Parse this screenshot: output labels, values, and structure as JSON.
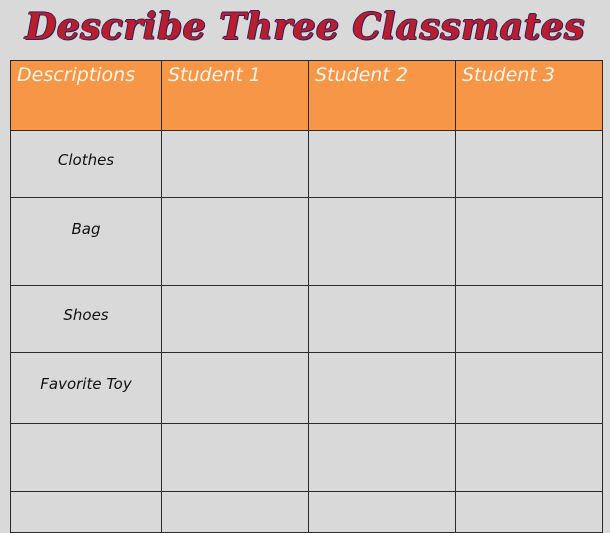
{
  "title": "Describe Three Classmates",
  "colors": {
    "title_fill": "#b81e2e",
    "title_outline": "#3a1f5a",
    "header_background": "#f79646",
    "header_text": "#fdf5ea",
    "cell_background": "#d9d9d9",
    "grid_line": "#2b2b2b"
  },
  "table": {
    "headers": [
      "Descriptions",
      "Student 1",
      "Student 2",
      "Student  3"
    ],
    "rows": [
      {
        "label": "Clothes",
        "cells": [
          "",
          "",
          ""
        ]
      },
      {
        "label": "Bag",
        "cells": [
          "",
          "",
          ""
        ]
      },
      {
        "label": "Shoes",
        "cells": [
          "",
          "",
          ""
        ]
      },
      {
        "label": "Favorite Toy",
        "cells": [
          "",
          "",
          ""
        ]
      },
      {
        "label": "",
        "cells": [
          "",
          "",
          ""
        ]
      },
      {
        "label": "",
        "cells": [
          "",
          "",
          ""
        ]
      }
    ]
  }
}
